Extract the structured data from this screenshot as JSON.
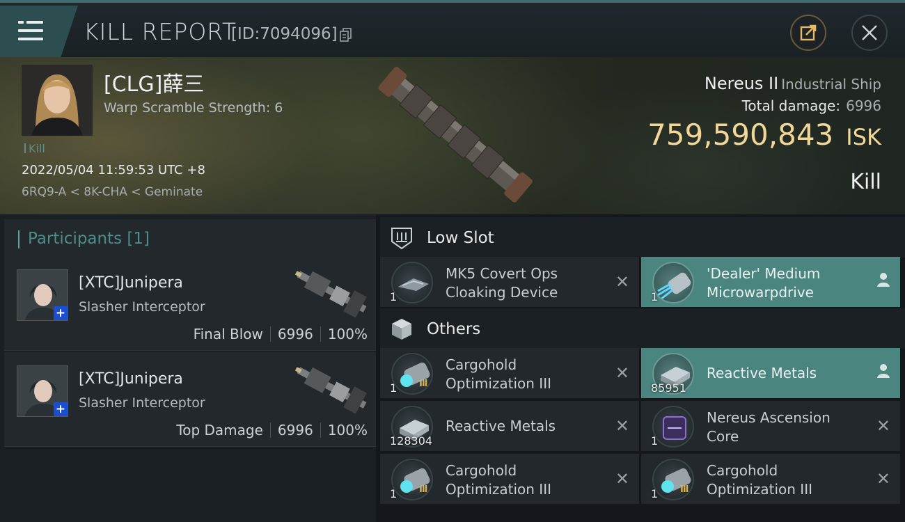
{
  "header": {
    "title": "KILL REPORT",
    "kill_id": "[ID:7094096]",
    "icons": {
      "menu": "menu-icon",
      "copy": "copy-icon",
      "share": "share-icon",
      "close": "close-icon"
    }
  },
  "victim": {
    "name": "[CLG]薛三",
    "warp_scramble": "Warp Scramble Strength: 6",
    "tag": "Kill",
    "datetime": "2022/05/04 11:59:53 UTC +8",
    "location": "6RQ9-A < 8K-CHA < Geminate",
    "ship_name": "Nereus II",
    "ship_class": "Industrial Ship",
    "total_damage_label": "Total damage:",
    "total_damage": "6996",
    "isk_value": "759,590,843",
    "isk_unit": "ISK",
    "result": "Kill"
  },
  "participants": {
    "title": "Participants [1]",
    "list": [
      {
        "name": "[XTC]Junipera",
        "ship": "Slasher Interceptor",
        "role": "Final Blow",
        "damage": "6996",
        "percent": "100%"
      },
      {
        "name": "[XTC]Junipera",
        "ship": "Slasher Interceptor",
        "role": "Top Damage",
        "damage": "6996",
        "percent": "100%"
      }
    ]
  },
  "sections": {
    "low_slot": "Low Slot",
    "others": "Others"
  },
  "low_slot_items": [
    {
      "line1": "MK5 Covert Ops",
      "line2": "Cloaking Device",
      "qty": "1",
      "status": "destroyed"
    },
    {
      "line1": "'Dealer' Medium",
      "line2": "Microwarpdrive",
      "qty": "1",
      "status": "dropped"
    }
  ],
  "other_items": [
    {
      "line1": "Cargohold",
      "line2": "Optimization III",
      "qty": "1",
      "status": "destroyed"
    },
    {
      "line1": "Reactive Metals",
      "line2": "",
      "qty": "85951",
      "status": "dropped"
    },
    {
      "line1": "Reactive Metals",
      "line2": "",
      "qty": "128304",
      "status": "destroyed"
    },
    {
      "line1": "Nereus Ascension",
      "line2": "Core",
      "qty": "1",
      "status": "destroyed"
    },
    {
      "line1": "Cargohold",
      "line2": "Optimization III",
      "qty": "1",
      "status": "destroyed"
    },
    {
      "line1": "Cargohold",
      "line2": "Optimization III",
      "qty": "1",
      "status": "destroyed"
    }
  ],
  "tech_marker": "III",
  "colors": {
    "accent": "#4b8580",
    "isk_gold": "#f1d79a",
    "participants_title": "#4d8e8a"
  }
}
